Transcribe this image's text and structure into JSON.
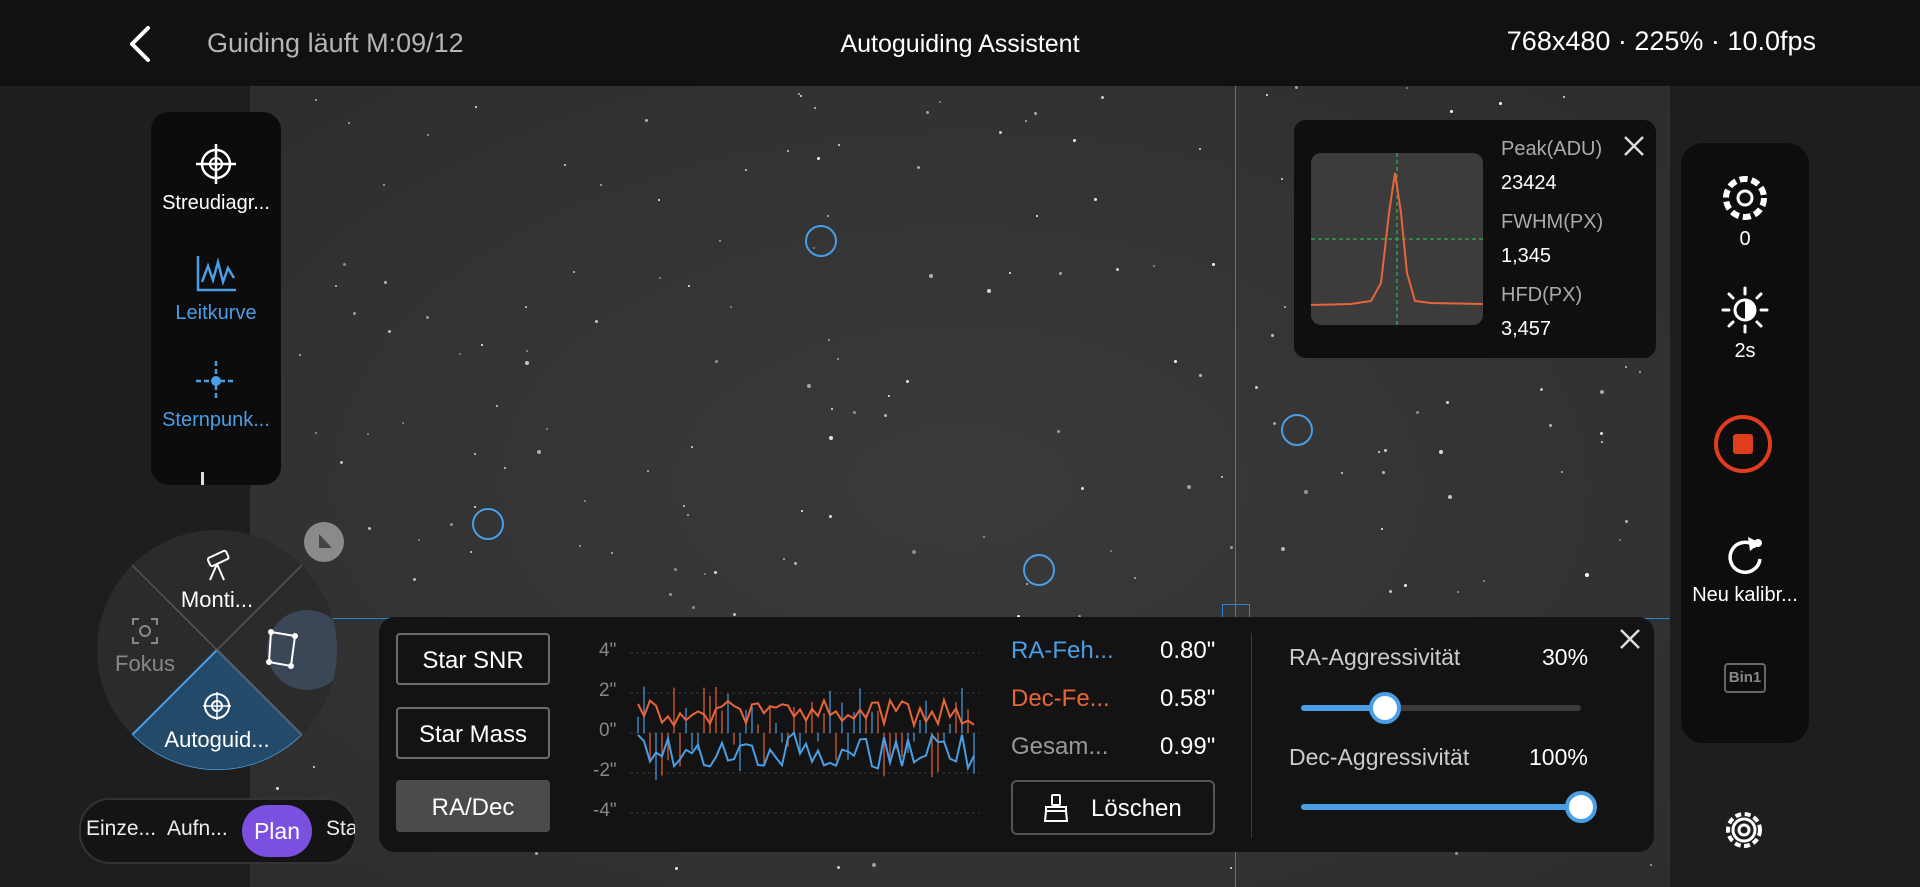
{
  "header": {
    "status": "Guiding läuft M:09/12",
    "title": "Autoguiding Assistent",
    "resolution_info": "768x480 · 225% · 10.0fps"
  },
  "left_tools": [
    {
      "label": "Streudiagr...",
      "icon": "crosshair-target-icon"
    },
    {
      "label": "Leitkurve",
      "icon": "graph-curve-icon"
    },
    {
      "label": "Sternpunk...",
      "icon": "star-point-icon"
    }
  ],
  "radial_menu": {
    "top": "Monti...",
    "left": "Fokus",
    "bottom": "Autoguid..."
  },
  "mode_tabs": [
    "Einze...",
    "Aufn...",
    "Plan",
    "Sta"
  ],
  "star_stats": {
    "peak_label": "Peak(ADU)",
    "peak_value": "23424",
    "fwhm_label": "FWHM(PX)",
    "fwhm_value": "1,345",
    "hfd_label": "HFD(PX)",
    "hfd_value": "3,457"
  },
  "right_panel": {
    "gain_value": "0",
    "exposure_value": "2s",
    "recalibrate_label": "Neu kalibr...",
    "bin_label": "Bin1"
  },
  "guide_panel": {
    "buttons": [
      "Star SNR",
      "Star Mass",
      "RA/Dec"
    ],
    "y_ticks": [
      "4\"",
      "2\"",
      "0\"",
      "-2\"",
      "-4\""
    ],
    "ra_error_label": "RA-Feh...",
    "ra_error_value": "0.80\"",
    "dec_error_label": "Dec-Fe...",
    "dec_error_value": "0.58\"",
    "total_label": "Gesam...",
    "total_value": "0.99\"",
    "clear_label": "Löschen",
    "ra_aggr_label": "RA-Aggressivität",
    "ra_aggr_value": "30%",
    "dec_aggr_label": "Dec-Aggressivität",
    "dec_aggr_value": "100%",
    "ra_aggr_level": 0.3,
    "dec_aggr_level": 1.0
  },
  "colors": {
    "accent_blue": "#4a9ee6",
    "dec_orange": "#e8653a",
    "record_red": "#e03c1e",
    "plan_purple": "#7b4fe0"
  }
}
